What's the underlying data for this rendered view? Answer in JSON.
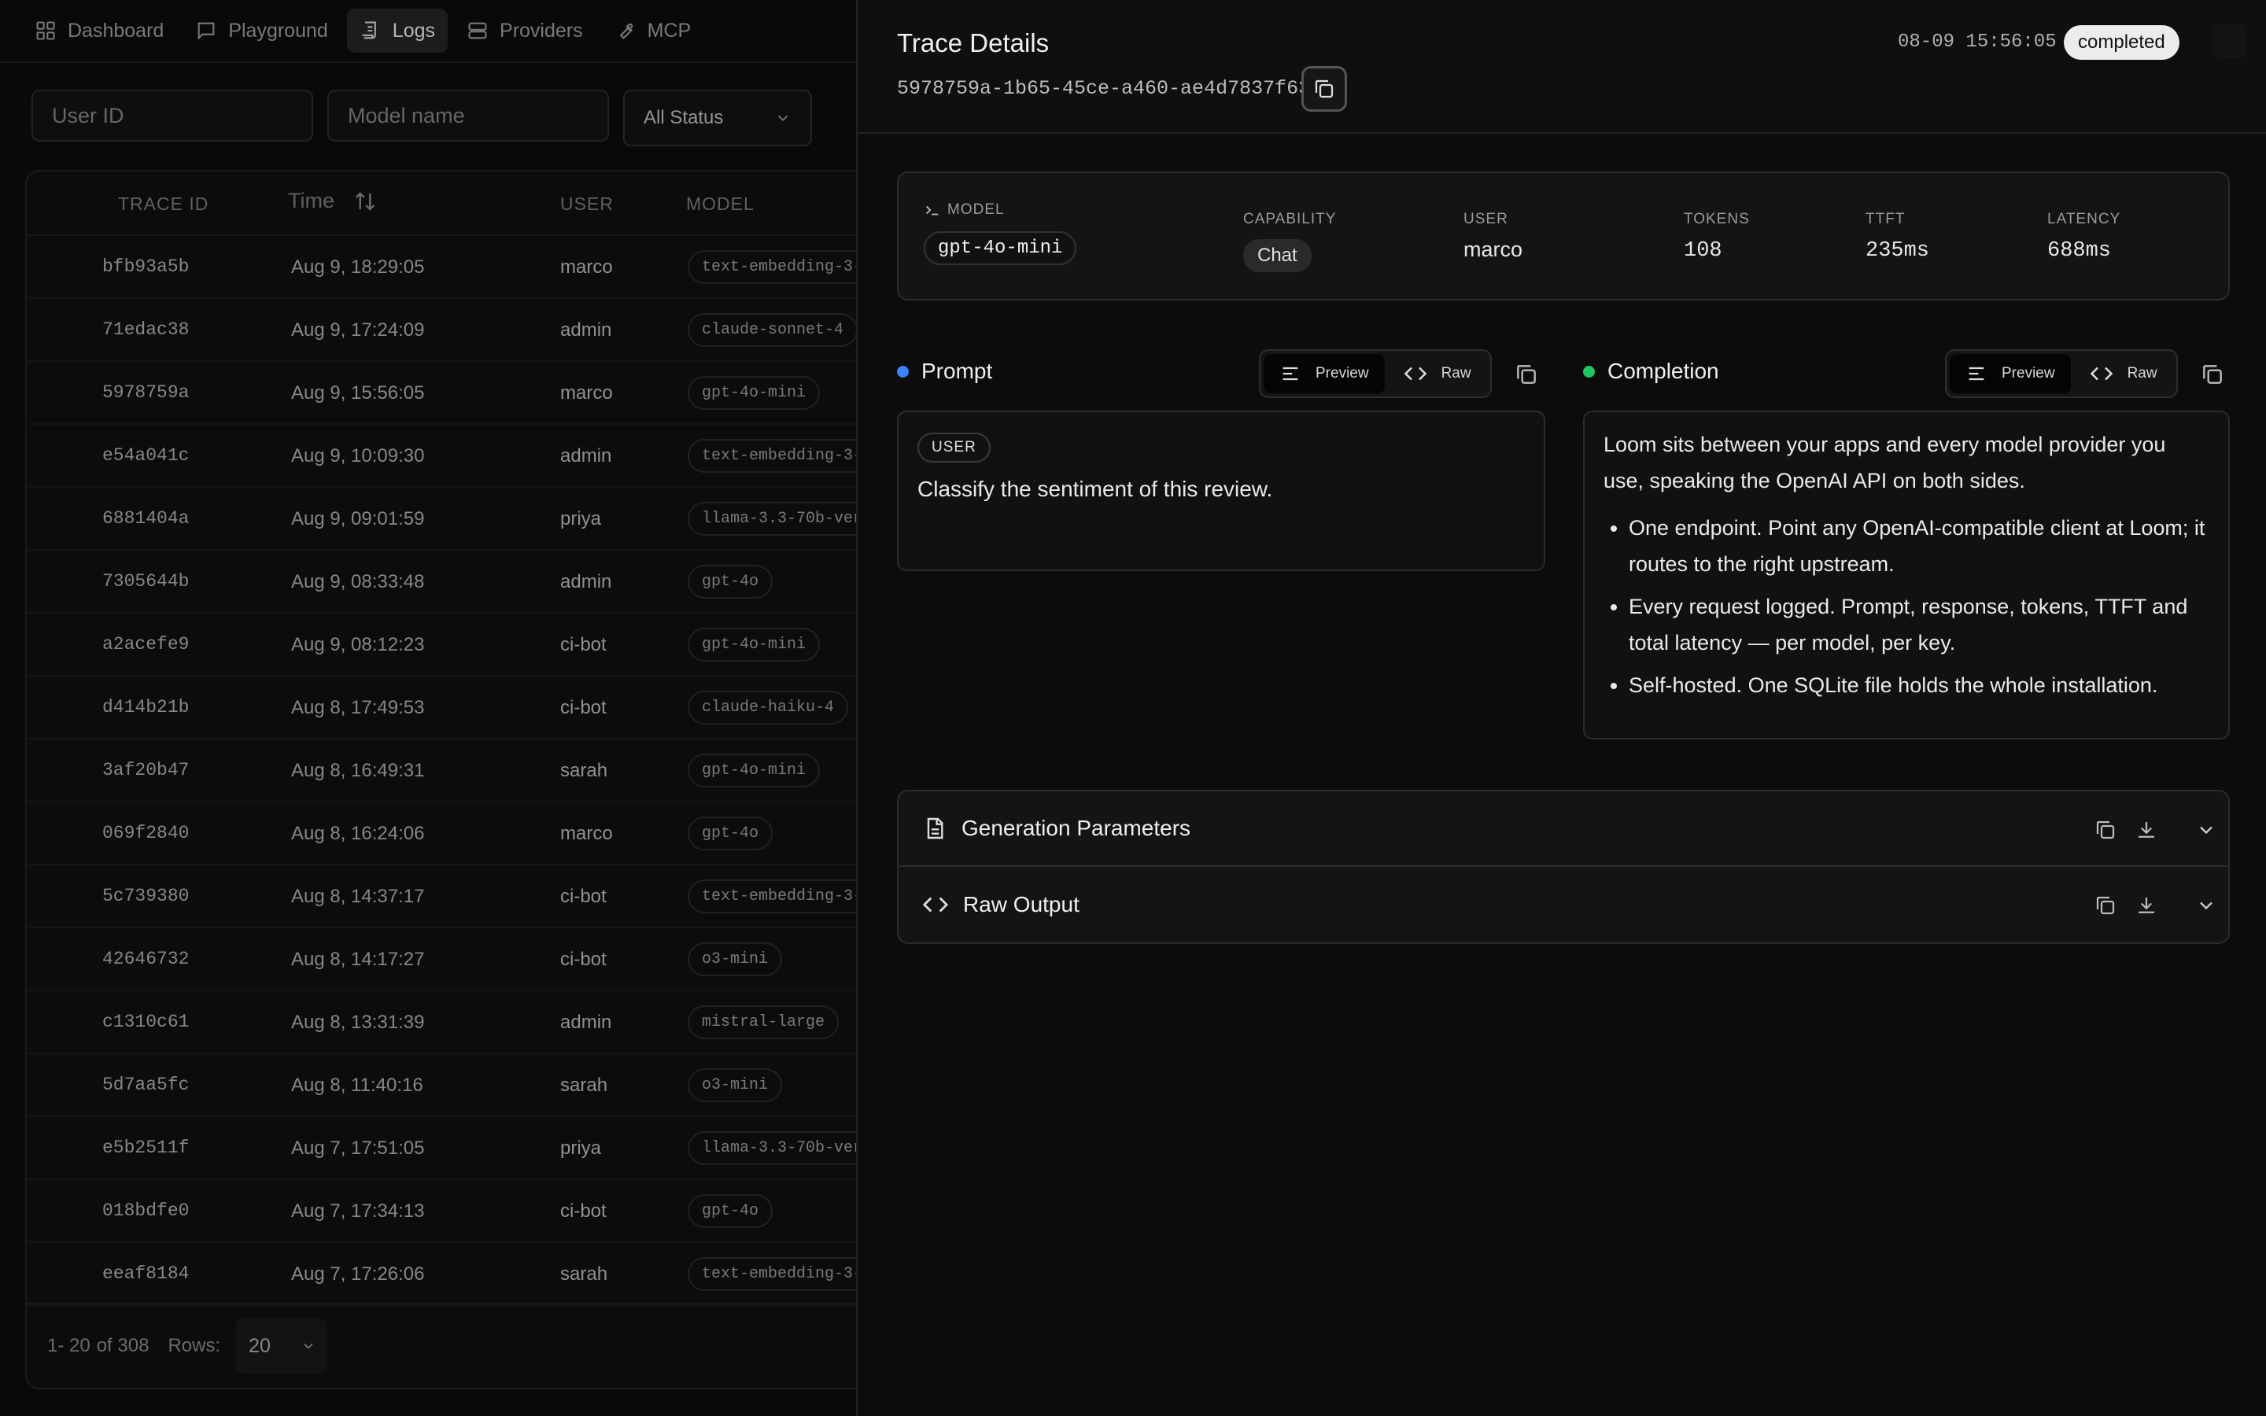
{
  "nav": {
    "items": [
      {
        "label": "Dashboard",
        "icon": "grid-icon"
      },
      {
        "label": "Playground",
        "icon": "chat-icon"
      },
      {
        "label": "Logs",
        "icon": "logs-icon"
      },
      {
        "label": "Providers",
        "icon": "server-icon"
      },
      {
        "label": "MCP",
        "icon": "wrench-icon"
      }
    ],
    "active": "Logs"
  },
  "filters": {
    "user_placeholder": "User ID",
    "model_placeholder": "Model name",
    "status_value": "All Status"
  },
  "table": {
    "headers": {
      "trace_id": "TRACE ID",
      "time": "Time",
      "user": "USER",
      "model": "MODEL"
    },
    "rows": [
      {
        "id": "bfb93a5b",
        "time": "Aug 9, 18:29:05",
        "user": "marco",
        "model": "text-embedding-3-"
      },
      {
        "id": "71edac38",
        "time": "Aug 9, 17:24:09",
        "user": "admin",
        "model": "claude-sonnet-4"
      },
      {
        "id": "5978759a",
        "time": "Aug 9, 15:56:05",
        "user": "marco",
        "model": "gpt-4o-mini"
      },
      {
        "id": "e54a041c",
        "time": "Aug 9, 10:09:30",
        "user": "admin",
        "model": "text-embedding-3-"
      },
      {
        "id": "6881404a",
        "time": "Aug 9, 09:01:59",
        "user": "priya",
        "model": "llama-3.3-70b-ver"
      },
      {
        "id": "7305644b",
        "time": "Aug 9, 08:33:48",
        "user": "admin",
        "model": "gpt-4o"
      },
      {
        "id": "a2acefe9",
        "time": "Aug 9, 08:12:23",
        "user": "ci-bot",
        "model": "gpt-4o-mini"
      },
      {
        "id": "d414b21b",
        "time": "Aug 8, 17:49:53",
        "user": "ci-bot",
        "model": "claude-haiku-4"
      },
      {
        "id": "3af20b47",
        "time": "Aug 8, 16:49:31",
        "user": "sarah",
        "model": "gpt-4o-mini"
      },
      {
        "id": "069f2840",
        "time": "Aug 8, 16:24:06",
        "user": "marco",
        "model": "gpt-4o"
      },
      {
        "id": "5c739380",
        "time": "Aug 8, 14:37:17",
        "user": "ci-bot",
        "model": "text-embedding-3-"
      },
      {
        "id": "42646732",
        "time": "Aug 8, 14:17:27",
        "user": "ci-bot",
        "model": "o3-mini"
      },
      {
        "id": "c1310c61",
        "time": "Aug 8, 13:31:39",
        "user": "admin",
        "model": "mistral-large"
      },
      {
        "id": "5d7aa5fc",
        "time": "Aug 8, 11:40:16",
        "user": "sarah",
        "model": "o3-mini"
      },
      {
        "id": "e5b2511f",
        "time": "Aug 7, 17:51:05",
        "user": "priya",
        "model": "llama-3.3-70b-ver"
      },
      {
        "id": "018bdfe0",
        "time": "Aug 7, 17:34:13",
        "user": "ci-bot",
        "model": "gpt-4o"
      },
      {
        "id": "eeaf8184",
        "time": "Aug 7, 17:26:06",
        "user": "sarah",
        "model": "text-embedding-3-"
      }
    ],
    "footer": {
      "range": "1- 20",
      "of": "of 308",
      "rows_label": "Rows:",
      "rows_value": "20"
    }
  },
  "drawer": {
    "title": "Trace Details",
    "trace_id": "5978759a-1b65-45ce-a460-ae4d7837f638",
    "timestamp": "08-09 15:56:05",
    "status": "completed",
    "meta": {
      "model_label": "MODEL",
      "model": "gpt-4o-mini",
      "capability_label": "CAPABILITY",
      "capability": "Chat",
      "user_label": "USER",
      "user": "marco",
      "tokens_label": "TOKENS",
      "tokens": "108",
      "ttft_label": "TTFT",
      "ttft": "235ms",
      "latency_label": "LATENCY",
      "latency": "688ms"
    },
    "prompt": {
      "title": "Prompt",
      "preview_label": "Preview",
      "raw_label": "Raw",
      "role": "USER",
      "text": "Classify the sentiment of this review.",
      "dot_color": "#3b82f6"
    },
    "completion": {
      "title": "Completion",
      "preview_label": "Preview",
      "raw_label": "Raw",
      "intro": "Loom sits between your apps and every model provider you use, speaking the OpenAI API on both sides.",
      "bullets": [
        "One endpoint. Point any OpenAI-compatible client at Loom; it routes to the right upstream.",
        "Every request logged. Prompt, response, tokens, TTFT and total latency — per model, per key.",
        "Self-hosted. One SQLite file holds the whole installation."
      ],
      "dot_color": "#22c55e"
    },
    "sections": [
      {
        "title": "Generation Parameters",
        "icon": "document-icon"
      },
      {
        "title": "Raw Output",
        "icon": "code-icon"
      }
    ]
  }
}
